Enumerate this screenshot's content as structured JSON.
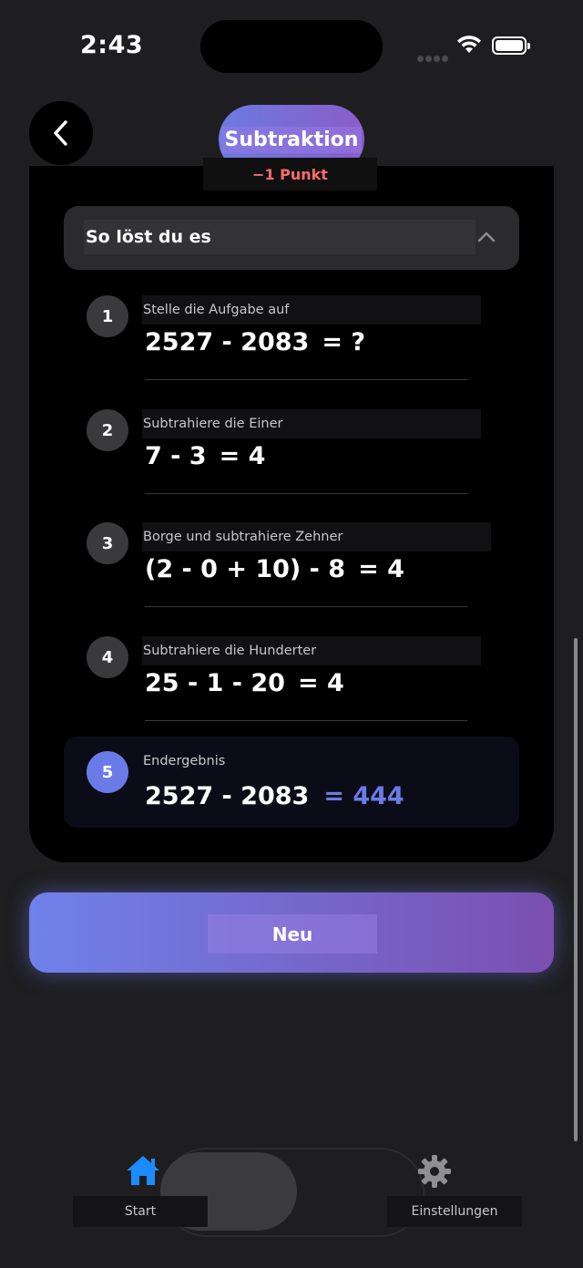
{
  "status_bar": {
    "time": "2:43"
  },
  "header": {
    "title": "Subtraktion",
    "points": "−1 Punkt"
  },
  "accordion": {
    "title": "So löst du es"
  },
  "steps": [
    {
      "number": "1",
      "label": "Stelle die Aufgabe auf",
      "expression": "2527 - 2083",
      "result": "= ?"
    },
    {
      "number": "2",
      "label": "Subtrahiere die Einer",
      "expression": "7 - 3",
      "result": "= 4"
    },
    {
      "number": "3",
      "label": "Borge und subtrahiere Zehner",
      "expression": "(2 - 0 + 10) - 8",
      "result": "= 4"
    },
    {
      "number": "4",
      "label": "Subtrahiere die Hunderter",
      "expression": "25 - 1 - 20",
      "result": "= 4"
    }
  ],
  "final": {
    "number": "5",
    "label": "Endergebnis",
    "expression": "2527 - 2083",
    "result": "= 444"
  },
  "new_button": {
    "label": "Neu"
  },
  "tabbar": {
    "start_label": "Start",
    "settings_label": "Einstellungen"
  },
  "colors": {
    "accent": "#6a7be8",
    "penalty": "#ff6b6b",
    "gradient_start": "#6f82ea",
    "gradient_end": "#7b4fb0"
  },
  "icons": {
    "back": "chevron-left-icon",
    "collapse": "chevron-up-icon",
    "start": "house-icon",
    "settings": "gear-icon"
  }
}
